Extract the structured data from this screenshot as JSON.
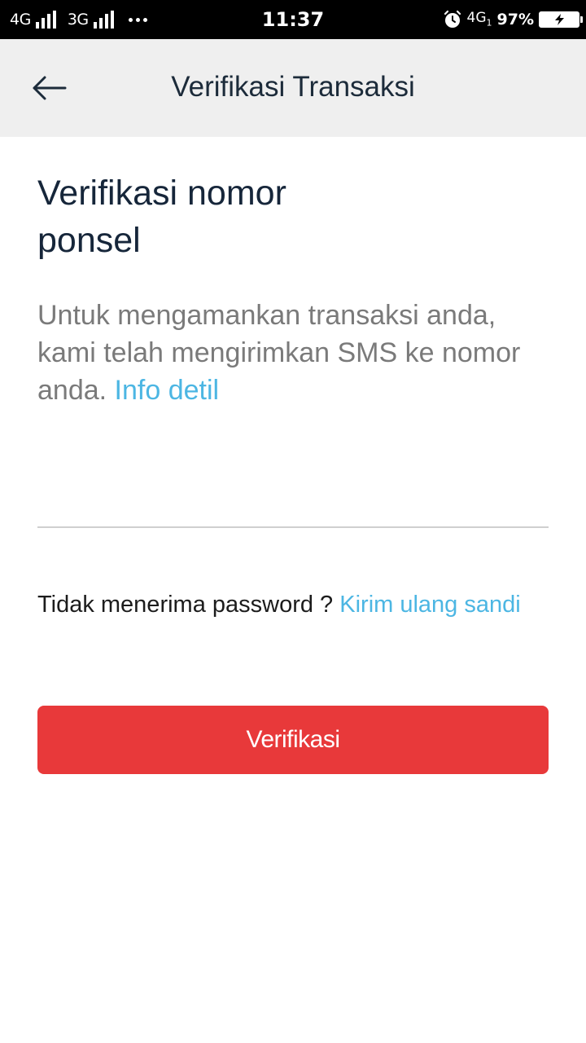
{
  "status_bar": {
    "network_1": "4G",
    "network_2": "3G",
    "time": "11:37",
    "network_right": "4G",
    "network_right_sub": "1",
    "battery": "97%",
    "icons": [
      "signal-icon",
      "more-dots-icon",
      "alarm-icon",
      "battery-charging-icon"
    ]
  },
  "app_bar": {
    "title": "Verifikasi Transaksi",
    "back_icon": "arrow-left-icon"
  },
  "main": {
    "heading": "Verifikasi nomor ponsel",
    "description": "Untuk mengamankan transaksi anda, kami telah mengirimkan SMS ke nomor anda.",
    "info_link": "Info detil",
    "otp_input": {
      "value": "",
      "placeholder": ""
    },
    "resend_text": "Tidak menerima password ?",
    "resend_link": "Kirim ulang sandi",
    "verify_button": "Verifikasi"
  },
  "colors": {
    "accent_link": "#4cb6e3",
    "primary_button": "#e8393a",
    "app_bar_bg": "#efefef",
    "status_bar_bg": "#000000"
  }
}
